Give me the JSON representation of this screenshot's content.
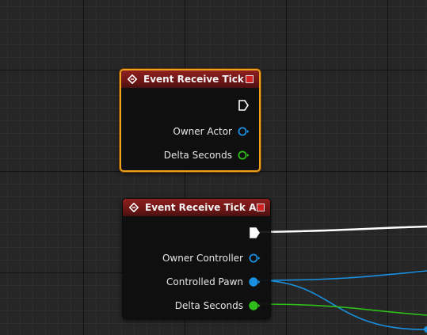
{
  "graph": {
    "nodes": [
      {
        "id": "event-receive-tick",
        "title": "Event Receive Tick",
        "selected": true,
        "exec_output_connected": false,
        "pins": [
          {
            "label": "Owner Actor",
            "type": "object",
            "color": "#1a90e0",
            "connected": false
          },
          {
            "label": "Delta Seconds",
            "type": "float",
            "color": "#2fbf1a",
            "connected": false
          }
        ]
      },
      {
        "id": "event-receive-tick-ai",
        "title": "Event Receive Tick AI",
        "selected": false,
        "exec_output_connected": true,
        "pins": [
          {
            "label": "Owner Controller",
            "type": "object",
            "color": "#1a90e0",
            "connected": false
          },
          {
            "label": "Controlled Pawn",
            "type": "object",
            "color": "#1a90e0",
            "connected": true
          },
          {
            "label": "Delta Seconds",
            "type": "float",
            "color": "#2fbf1a",
            "connected": true
          }
        ]
      }
    ],
    "colors": {
      "exec": "#ffffff",
      "object": "#1a90e0",
      "float": "#2fbf1a",
      "header": "#8e1f1f",
      "selection": "#f0a020"
    }
  }
}
